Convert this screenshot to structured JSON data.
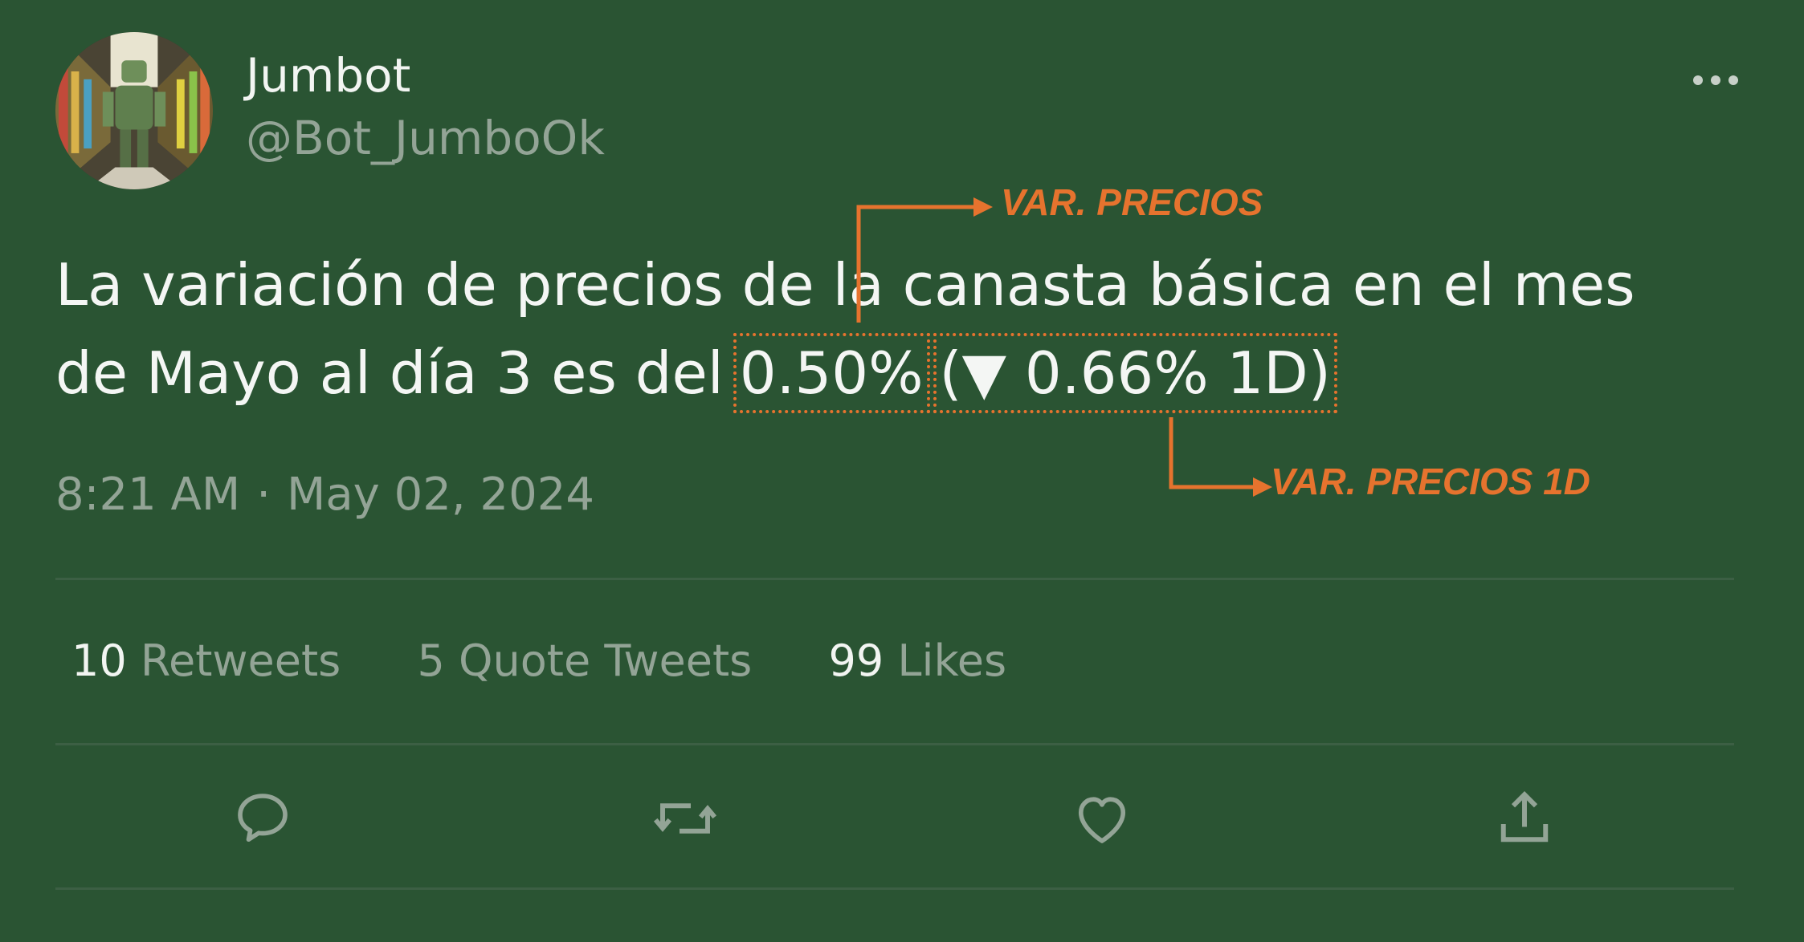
{
  "user": {
    "display_name": "Jumbot",
    "handle": "@Bot_JumboOk"
  },
  "tweet": {
    "line1": "La variación de precios de la canasta básica en el mes",
    "line2_prefix": "de Mayo al día 3 es del",
    "monthly_variation": "0.50%",
    "daily_variation": "(▼ 0.66% 1D)",
    "time": "8:21 AM",
    "separator": "·",
    "date": "May 02, 2024"
  },
  "annotations": {
    "top_label": "VAR. PRECIOS",
    "bottom_label": "VAR. PRECIOS 1D",
    "color": "#e6732e"
  },
  "stats": {
    "retweets_count": "10",
    "retweets_label": "Retweets",
    "quotes_count": "5",
    "quotes_label": "Quote Tweets",
    "likes_count": "99",
    "likes_label": "Likes"
  },
  "actions": [
    "reply-icon",
    "retweet-icon",
    "like-icon",
    "share-icon"
  ],
  "colors": {
    "background": "#2a5433",
    "text": "#f2f5f2",
    "muted": "#93a496",
    "accent": "#e6732e"
  }
}
